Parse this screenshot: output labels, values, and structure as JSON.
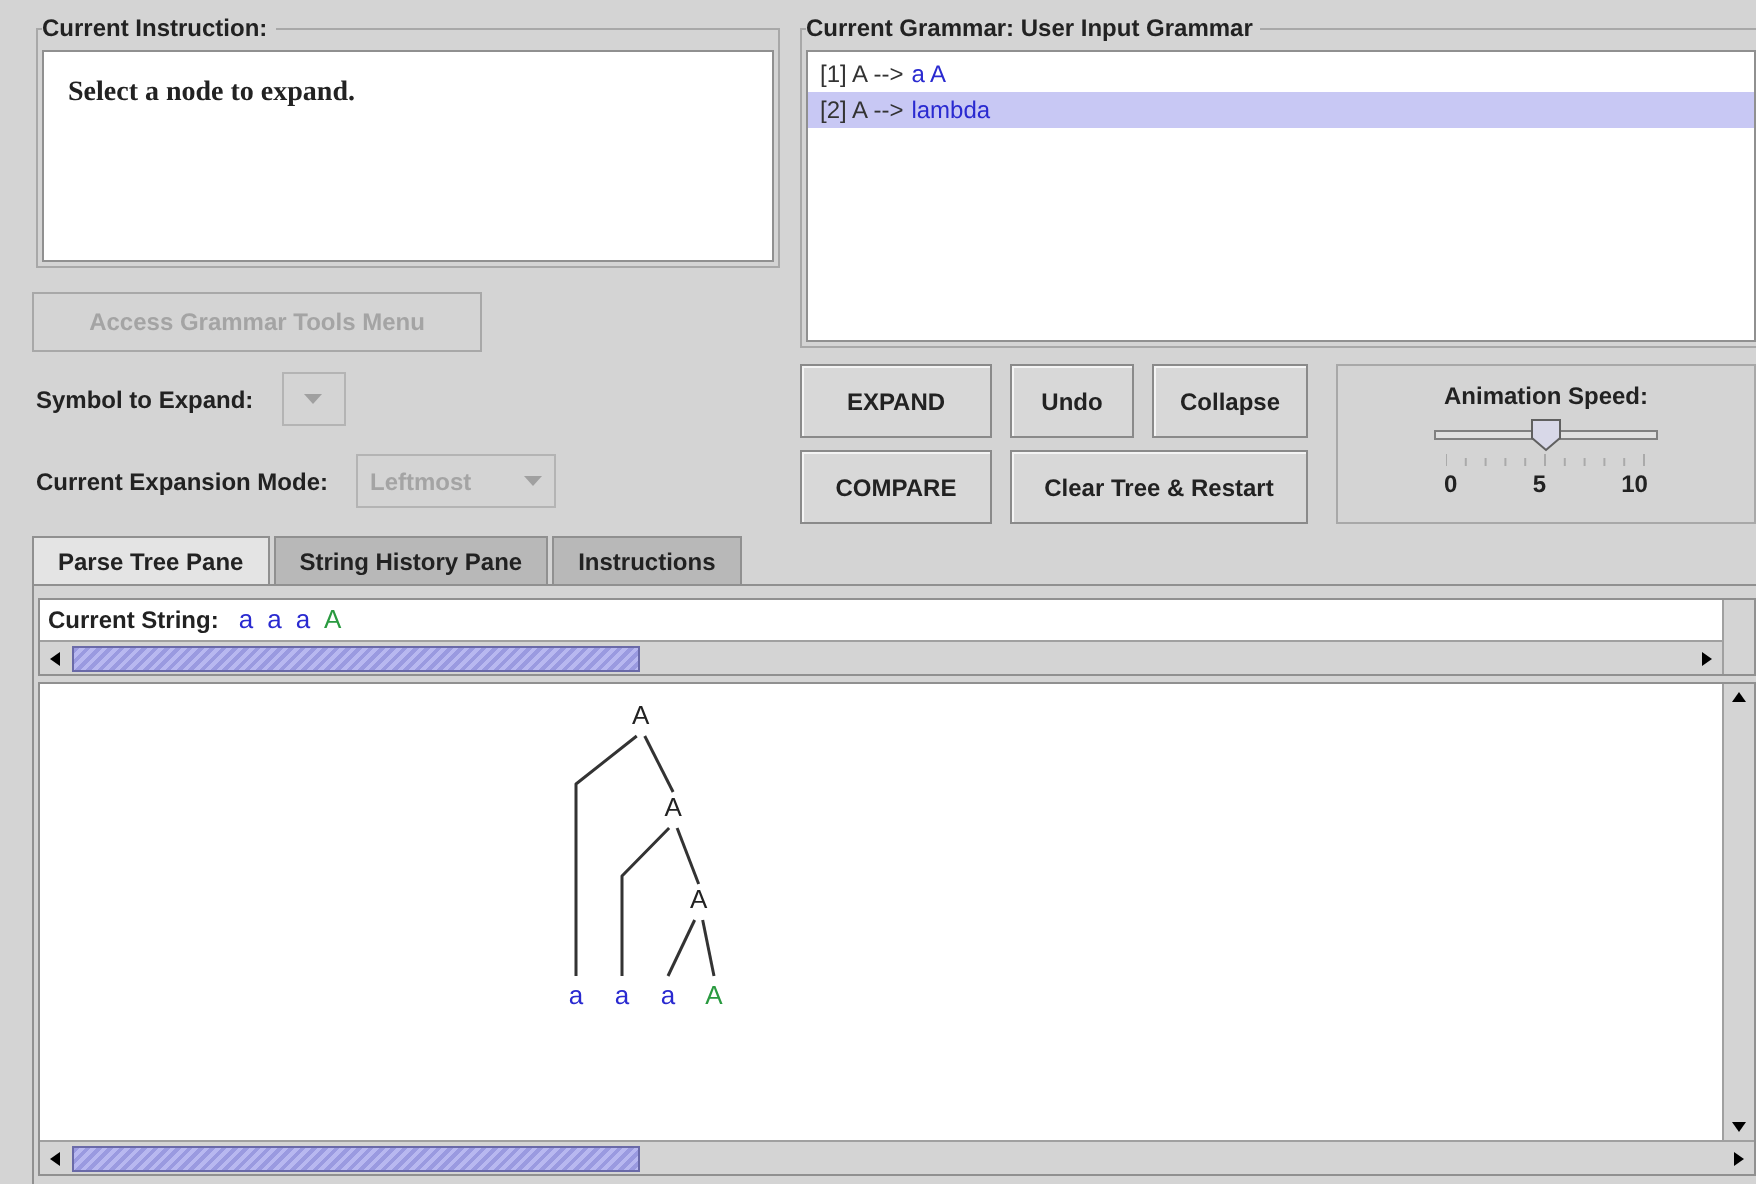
{
  "instruction": {
    "title": "Current Instruction:",
    "text": "Select a node to expand."
  },
  "grammar": {
    "title": "Current Grammar: User Input Grammar",
    "rules": [
      {
        "index": "[1]",
        "lhs": "A",
        "arrow": "-->",
        "rhs": "a A",
        "selected": false
      },
      {
        "index": "[2]",
        "lhs": "A",
        "arrow": "-->",
        "rhs": "lambda",
        "selected": true
      }
    ]
  },
  "tools_button": {
    "label": "Access Grammar Tools Menu",
    "disabled": true
  },
  "symbol_to_expand": {
    "label": "Symbol to Expand:",
    "disabled": true
  },
  "expansion_mode": {
    "label": "Current Expansion Mode:",
    "value": "Leftmost",
    "disabled": true
  },
  "buttons": [
    {
      "label": "EXPAND"
    },
    {
      "label": "Undo"
    },
    {
      "label": "Collapse"
    },
    {
      "label": "COMPARE"
    },
    {
      "label": "Clear Tree & Restart"
    }
  ],
  "animation_speed": {
    "title": "Animation Speed:",
    "level": 0.5,
    "tick_labels": [
      "0",
      "5",
      "10"
    ]
  },
  "tabs": [
    {
      "label": "Parse Tree Pane",
      "selected": true
    },
    {
      "label": "String History Pane",
      "selected": false
    },
    {
      "label": "Instructions",
      "selected": false
    }
  ],
  "current_string": {
    "label": "Current String:",
    "symbols": [
      {
        "text": "a",
        "kind": "terminal"
      },
      {
        "text": "a",
        "kind": "terminal"
      },
      {
        "text": "a",
        "kind": "terminal"
      },
      {
        "text": "A",
        "kind": "nonterminal"
      }
    ]
  },
  "parse_tree": {
    "text": "A",
    "children": [
      {
        "text": "a",
        "kind": "terminal"
      },
      {
        "text": "A",
        "children": [
          {
            "text": "a",
            "kind": "terminal"
          },
          {
            "text": "A",
            "children": [
              {
                "text": "a",
                "kind": "terminal"
              },
              {
                "text": "A",
                "kind": "nonterminal"
              }
            ]
          }
        ]
      }
    ]
  }
}
